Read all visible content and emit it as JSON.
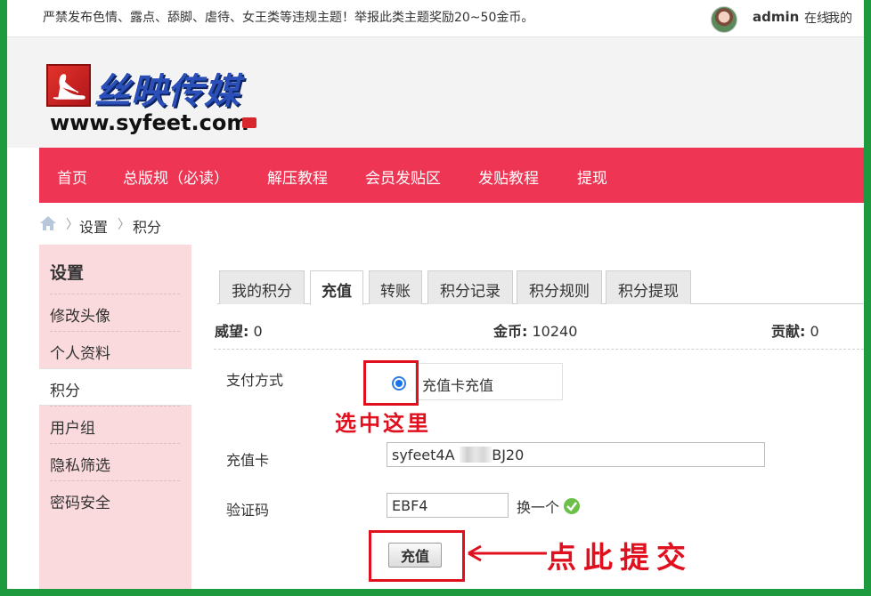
{
  "topbar": {
    "notice": "严禁发布色情、露点、舔脚、虐待、女王类等违规主题！举报此类主题奖励20~50金币。",
    "username": "admin",
    "status": "在线",
    "mine": "我的"
  },
  "logo": {
    "title": "丝映传媒",
    "url": "www.syfeet.com"
  },
  "nav": {
    "items": [
      "首页",
      "总版规（必读）",
      "解压教程",
      "会员发贴区",
      "发贴教程",
      "提现"
    ]
  },
  "breadcrumb": {
    "items": [
      "设置",
      "积分"
    ]
  },
  "sidebar": {
    "title": "设置",
    "items": [
      "修改头像",
      "个人资料",
      "积分",
      "用户组",
      "隐私筛选",
      "密码安全"
    ],
    "active_index": 2
  },
  "tabs": {
    "items": [
      "我的积分",
      "充值",
      "转账",
      "积分记录",
      "积分规则",
      "积分提现"
    ],
    "active_index": 1
  },
  "stats": {
    "prestige_label": "威望:",
    "prestige_value": "0",
    "coins_label": "金币:",
    "coins_value": "10240",
    "contribution_label": "贡献:",
    "contribution_value": "0"
  },
  "form": {
    "pay_method_label": "支付方式",
    "pay_option": "充值卡充值",
    "card_label": "充值卡",
    "card_value": "syfeet4A      CBJ20",
    "captcha_label": "验证码",
    "captcha_value": "EBF4",
    "captcha_refresh": "换一个",
    "submit_label": "充值"
  },
  "annotations": {
    "select_hint": "选中这里",
    "submit_hint": "点此提交",
    "color": "#e0101f"
  },
  "colors": {
    "nav_bg": "#ee3553",
    "sidebar_bg": "#fadadd",
    "frame_border": "#1e9a3e"
  }
}
